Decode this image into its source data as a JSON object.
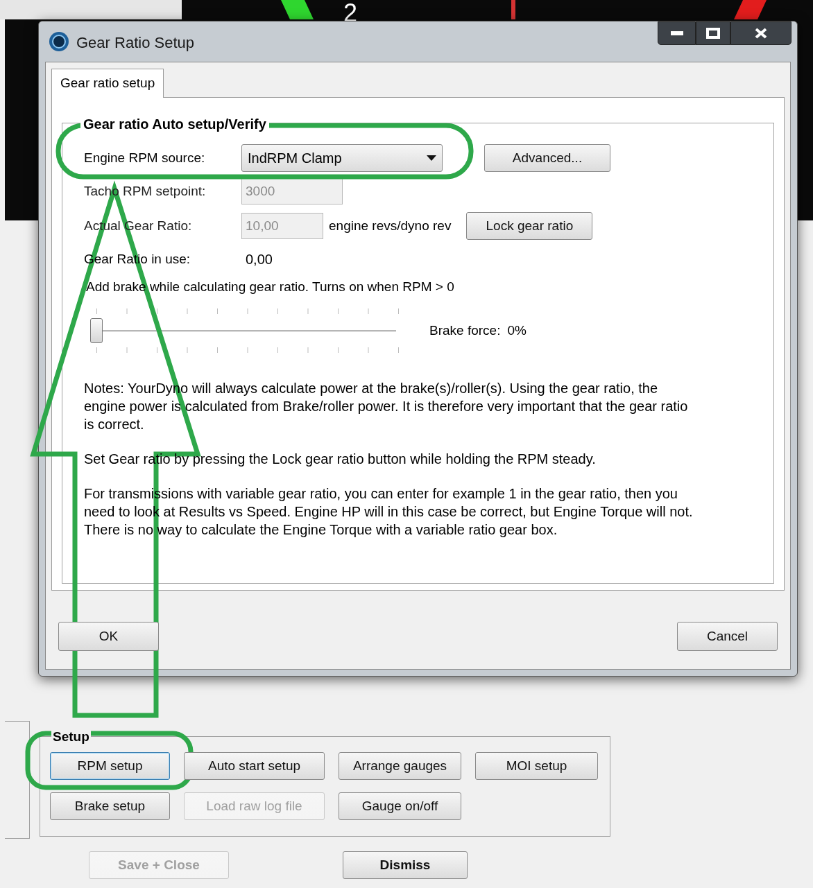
{
  "background": {
    "gauge_digit": "2"
  },
  "window": {
    "title": "Gear Ratio Setup"
  },
  "tabs": [
    {
      "label": "Gear ratio setup",
      "selected": true
    }
  ],
  "group": {
    "title": "Gear ratio Auto setup/Verify"
  },
  "engine_rpm_source": {
    "label": "Engine RPM source:",
    "value": "IndRPM Clamp"
  },
  "advanced_button": {
    "label": "Advanced..."
  },
  "tacho_rpm_setpoint": {
    "label": "Tacho RPM setpoint:",
    "value": "3000",
    "disabled": true
  },
  "actual_gear_ratio": {
    "label": "Actual Gear Ratio:",
    "value": "10,00",
    "disabled": true,
    "unit": "engine revs/dyno rev"
  },
  "lock_button": {
    "label": "Lock gear ratio"
  },
  "gear_ratio_in_use": {
    "label": "Gear Ratio in use:",
    "value": "0,00"
  },
  "brake_hint": "Add brake while calculating gear ratio. Turns on when RPM > 0",
  "brake_slider": {
    "level": 0
  },
  "brake_force": {
    "label": "Brake force:",
    "value": "0%"
  },
  "notes": [
    "Notes: YourDyno will always calculate power at the brake(s)/roller(s). Using the gear ratio, the engine power is calculated from Brake/roller power. It is therefore very important that the gear ratio is correct.",
    "Set Gear ratio by pressing the Lock gear ratio button while holding the RPM steady.",
    "For transmissions with variable gear ratio, you can enter for example 1 in the gear ratio, then you need to look at Results vs Speed. Engine HP will in this case be correct, but Engine Torque will not. There is no way to calculate the Engine Torque with a variable ratio gear box."
  ],
  "dialog_buttons": [
    {
      "label": "OK"
    },
    {
      "label": "Cancel"
    }
  ],
  "setup": {
    "title": "Setup",
    "buttons": [
      {
        "label": "RPM setup",
        "disabled": false,
        "focused": true
      },
      {
        "label": "Auto start setup",
        "disabled": false,
        "focused": false
      },
      {
        "label": "Arrange gauges",
        "disabled": false,
        "focused": false
      },
      {
        "label": "MOI setup",
        "disabled": false,
        "focused": false
      },
      {
        "label": "Brake setup",
        "disabled": false,
        "focused": false
      },
      {
        "label": "Load raw log file",
        "disabled": true,
        "focused": false
      },
      {
        "label": "Gauge on/off",
        "disabled": false,
        "focused": false
      }
    ]
  },
  "footer_buttons": [
    {
      "label": "Save + Close",
      "disabled": true
    },
    {
      "label": "Dismiss",
      "disabled": false
    }
  ]
}
